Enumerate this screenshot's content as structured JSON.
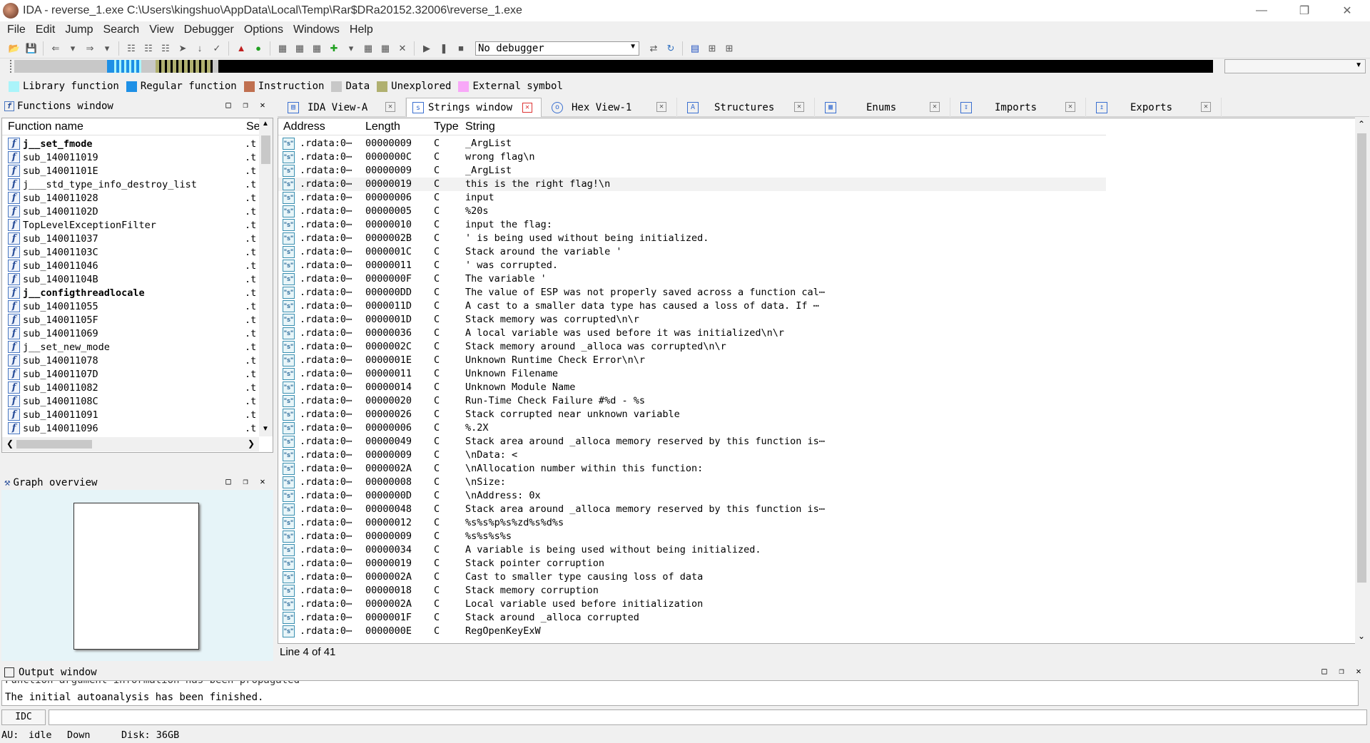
{
  "window": {
    "title": "IDA - reverse_1.exe C:\\Users\\kingshuo\\AppData\\Local\\Temp\\Rar$DRa20152.32006\\reverse_1.exe"
  },
  "menu": [
    "File",
    "Edit",
    "Jump",
    "Search",
    "View",
    "Debugger",
    "Options",
    "Windows",
    "Help"
  ],
  "toolbar": {
    "debugger": "No debugger"
  },
  "legend": [
    {
      "label": "Library function",
      "color": "#aaf4fa"
    },
    {
      "label": "Regular function",
      "color": "#1e90e6"
    },
    {
      "label": "Instruction",
      "color": "#c07050"
    },
    {
      "label": "Data",
      "color": "#c8c8c8"
    },
    {
      "label": "Unexplored",
      "color": "#b0b070"
    },
    {
      "label": "External symbol",
      "color": "#f8a8f8"
    }
  ],
  "functions_window": {
    "title": "Functions window",
    "col_name": "Function name",
    "col_seg": "Se",
    "rows": [
      {
        "name": "j__set_fmode",
        "seg": ".t",
        "bold": true
      },
      {
        "name": "sub_140011019",
        "seg": ".t",
        "bold": false
      },
      {
        "name": "sub_14001101E",
        "seg": ".t",
        "bold": false
      },
      {
        "name": "j___std_type_info_destroy_list",
        "seg": ".t",
        "bold": false
      },
      {
        "name": "sub_140011028",
        "seg": ".t",
        "bold": false
      },
      {
        "name": "sub_14001102D",
        "seg": ".t",
        "bold": false
      },
      {
        "name": "TopLevelExceptionFilter",
        "seg": ".t",
        "bold": false
      },
      {
        "name": "sub_140011037",
        "seg": ".t",
        "bold": false
      },
      {
        "name": "sub_14001103C",
        "seg": ".t",
        "bold": false
      },
      {
        "name": "sub_140011046",
        "seg": ".t",
        "bold": false
      },
      {
        "name": "sub_14001104B",
        "seg": ".t",
        "bold": false
      },
      {
        "name": "j__configthreadlocale",
        "seg": ".t",
        "bold": true
      },
      {
        "name": "sub_140011055",
        "seg": ".t",
        "bold": false
      },
      {
        "name": "sub_14001105F",
        "seg": ".t",
        "bold": false
      },
      {
        "name": "sub_140011069",
        "seg": ".t",
        "bold": false
      },
      {
        "name": "j__set_new_mode",
        "seg": ".t",
        "bold": false
      },
      {
        "name": "sub_140011078",
        "seg": ".t",
        "bold": false
      },
      {
        "name": "sub_14001107D",
        "seg": ".t",
        "bold": false
      },
      {
        "name": "sub_140011082",
        "seg": ".t",
        "bold": false
      },
      {
        "name": "sub_14001108C",
        "seg": ".t",
        "bold": false
      },
      {
        "name": "sub_140011091",
        "seg": ".t",
        "bold": false
      },
      {
        "name": "sub_140011096",
        "seg": ".t",
        "bold": false
      }
    ]
  },
  "graph_overview": {
    "title": "Graph overview"
  },
  "tabs": [
    {
      "label": "IDA View-A",
      "active": false
    },
    {
      "label": "Strings window",
      "active": true
    },
    {
      "label": "Hex View-1",
      "active": false
    },
    {
      "label": "Structures",
      "active": false
    },
    {
      "label": "Enums",
      "active": false
    },
    {
      "label": "Imports",
      "active": false
    },
    {
      "label": "Exports",
      "active": false
    }
  ],
  "strings_window": {
    "columns": [
      "Address",
      "Length",
      "Type",
      "String"
    ],
    "selected_index": 3,
    "rows": [
      {
        "addr": ".rdata:0⋯",
        "len": "00000009",
        "type": "C",
        "str": "_ArgList"
      },
      {
        "addr": ".rdata:0⋯",
        "len": "0000000C",
        "type": "C",
        "str": "wrong flag\\n"
      },
      {
        "addr": ".rdata:0⋯",
        "len": "00000009",
        "type": "C",
        "str": "_ArgList"
      },
      {
        "addr": ".rdata:0⋯",
        "len": "00000019",
        "type": "C",
        "str": "this is the right flag!\\n"
      },
      {
        "addr": ".rdata:0⋯",
        "len": "00000006",
        "type": "C",
        "str": "input"
      },
      {
        "addr": ".rdata:0⋯",
        "len": "00000005",
        "type": "C",
        "str": "%20s"
      },
      {
        "addr": ".rdata:0⋯",
        "len": "00000010",
        "type": "C",
        "str": "input the flag:"
      },
      {
        "addr": ".rdata:0⋯",
        "len": "0000002B",
        "type": "C",
        "str": "' is being used without being initialized."
      },
      {
        "addr": ".rdata:0⋯",
        "len": "0000001C",
        "type": "C",
        "str": "Stack around the variable '"
      },
      {
        "addr": ".rdata:0⋯",
        "len": "00000011",
        "type": "C",
        "str": "' was corrupted."
      },
      {
        "addr": ".rdata:0⋯",
        "len": "0000000F",
        "type": "C",
        "str": "The variable '"
      },
      {
        "addr": ".rdata:0⋯",
        "len": "000000DD",
        "type": "C",
        "str": "The value of ESP was not properly saved across a function cal⋯"
      },
      {
        "addr": ".rdata:0⋯",
        "len": "0000011D",
        "type": "C",
        "str": "A cast to a smaller data type has caused a loss of data.  If ⋯"
      },
      {
        "addr": ".rdata:0⋯",
        "len": "0000001D",
        "type": "C",
        "str": "Stack memory was corrupted\\n\\r"
      },
      {
        "addr": ".rdata:0⋯",
        "len": "00000036",
        "type": "C",
        "str": "A local variable was used before it was initialized\\n\\r"
      },
      {
        "addr": ".rdata:0⋯",
        "len": "0000002C",
        "type": "C",
        "str": "Stack memory around _alloca was corrupted\\n\\r"
      },
      {
        "addr": ".rdata:0⋯",
        "len": "0000001E",
        "type": "C",
        "str": "Unknown Runtime Check Error\\n\\r"
      },
      {
        "addr": ".rdata:0⋯",
        "len": "00000011",
        "type": "C",
        "str": "Unknown Filename"
      },
      {
        "addr": ".rdata:0⋯",
        "len": "00000014",
        "type": "C",
        "str": "Unknown Module Name"
      },
      {
        "addr": ".rdata:0⋯",
        "len": "00000020",
        "type": "C",
        "str": "Run-Time Check Failure #%d - %s"
      },
      {
        "addr": ".rdata:0⋯",
        "len": "00000026",
        "type": "C",
        "str": "Stack corrupted near unknown variable"
      },
      {
        "addr": ".rdata:0⋯",
        "len": "00000006",
        "type": "C",
        "str": "%.2X"
      },
      {
        "addr": ".rdata:0⋯",
        "len": "00000049",
        "type": "C",
        "str": "Stack area around _alloca memory reserved by this function is⋯"
      },
      {
        "addr": ".rdata:0⋯",
        "len": "00000009",
        "type": "C",
        "str": "\\nData: <"
      },
      {
        "addr": ".rdata:0⋯",
        "len": "0000002A",
        "type": "C",
        "str": "\\nAllocation number within this function:"
      },
      {
        "addr": ".rdata:0⋯",
        "len": "00000008",
        "type": "C",
        "str": "\\nSize:"
      },
      {
        "addr": ".rdata:0⋯",
        "len": "0000000D",
        "type": "C",
        "str": "\\nAddress: 0x"
      },
      {
        "addr": ".rdata:0⋯",
        "len": "00000048",
        "type": "C",
        "str": "Stack area around _alloca memory reserved by this function is⋯"
      },
      {
        "addr": ".rdata:0⋯",
        "len": "00000012",
        "type": "C",
        "str": "%s%s%p%s%zd%s%d%s"
      },
      {
        "addr": ".rdata:0⋯",
        "len": "00000009",
        "type": "C",
        "str": "%s%s%s%s"
      },
      {
        "addr": ".rdata:0⋯",
        "len": "00000034",
        "type": "C",
        "str": "A variable is being used without being initialized."
      },
      {
        "addr": ".rdata:0⋯",
        "len": "00000019",
        "type": "C",
        "str": "Stack pointer corruption"
      },
      {
        "addr": ".rdata:0⋯",
        "len": "0000002A",
        "type": "C",
        "str": "Cast to smaller type causing loss of data"
      },
      {
        "addr": ".rdata:0⋯",
        "len": "00000018",
        "type": "C",
        "str": "Stack memory corruption"
      },
      {
        "addr": ".rdata:0⋯",
        "len": "0000002A",
        "type": "C",
        "str": "Local variable used before initialization"
      },
      {
        "addr": ".rdata:0⋯",
        "len": "0000001F",
        "type": "C",
        "str": "Stack around _alloca corrupted"
      },
      {
        "addr": ".rdata:0⋯",
        "len": "0000000E",
        "type": "C",
        "str": "RegOpenKeyExW"
      }
    ],
    "status": "Line 4 of 41"
  },
  "output_window": {
    "title": "Output window",
    "lines": [
      "Function argument information has been propagated",
      "The initial autoanalysis has been finished."
    ]
  },
  "command": {
    "button": "IDC"
  },
  "statusbar": {
    "au_label": "AU:",
    "au_state": "idle",
    "direction": "Down",
    "disk": "Disk: 36GB"
  }
}
